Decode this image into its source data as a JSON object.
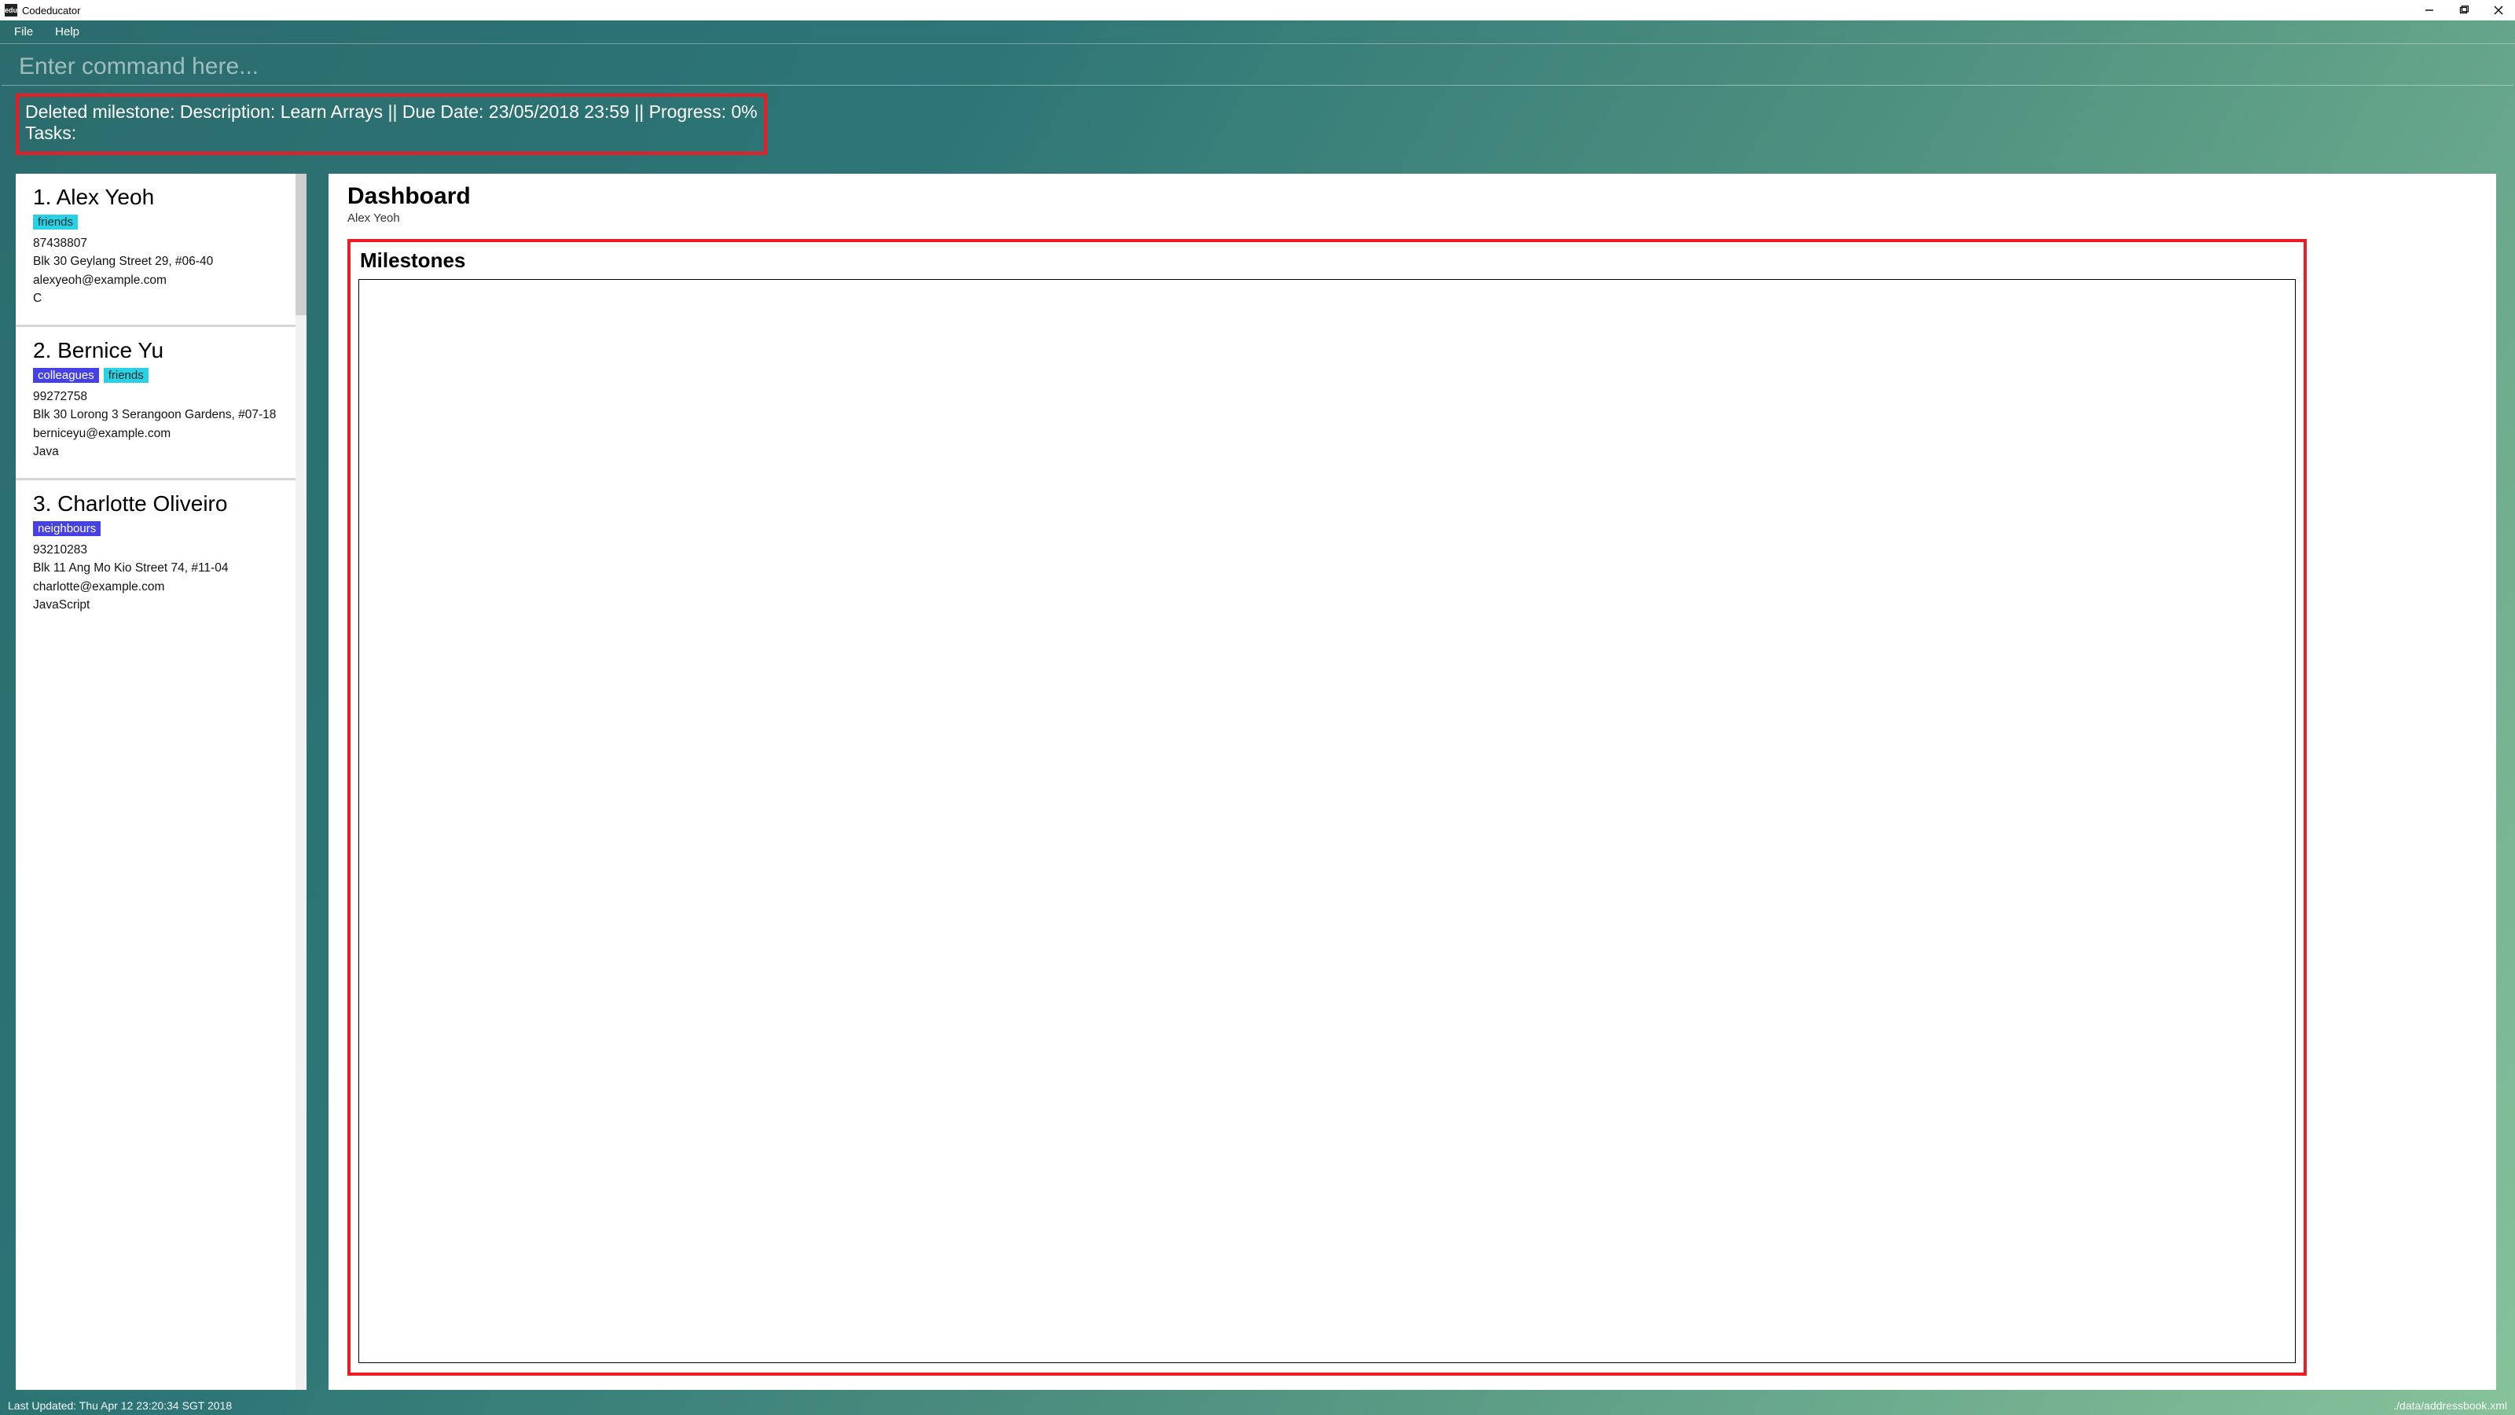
{
  "window": {
    "title": "Codeducator",
    "app_icon_text": "edu"
  },
  "menubar": {
    "file": "File",
    "help": "Help"
  },
  "command": {
    "placeholder": "Enter command here...",
    "value": ""
  },
  "result": {
    "line1": "Deleted milestone: Description: Learn Arrays || Due Date: 23/05/2018 23:59 || Progress: 0%",
    "line2": "Tasks:"
  },
  "people": [
    {
      "index": "1.",
      "name": "Alex Yeoh",
      "tags": [
        {
          "text": "friends",
          "cls": "friends"
        }
      ],
      "phone": "87438807",
      "address": "Blk 30 Geylang Street 29, #06-40",
      "email": "alexyeoh@example.com",
      "lang": "C"
    },
    {
      "index": "2.",
      "name": "Bernice Yu",
      "tags": [
        {
          "text": "colleagues",
          "cls": "colleagues"
        },
        {
          "text": "friends",
          "cls": "friends"
        }
      ],
      "phone": "99272758",
      "address": "Blk 30 Lorong 3 Serangoon Gardens, #07-18",
      "email": "berniceyu@example.com",
      "lang": "Java"
    },
    {
      "index": "3.",
      "name": "Charlotte Oliveiro",
      "tags": [
        {
          "text": "neighbours",
          "cls": "neighbours"
        }
      ],
      "phone": "93210283",
      "address": "Blk 11 Ang Mo Kio Street 74, #11-04",
      "email": "charlotte@example.com",
      "lang": "JavaScript"
    }
  ],
  "dashboard": {
    "title": "Dashboard",
    "subtitle": "Alex Yeoh",
    "milestones_title": "Milestones"
  },
  "status": {
    "left": "Last Updated: Thu Apr 12 23:20:34 SGT 2018",
    "right": "./data/addressbook.xml"
  }
}
